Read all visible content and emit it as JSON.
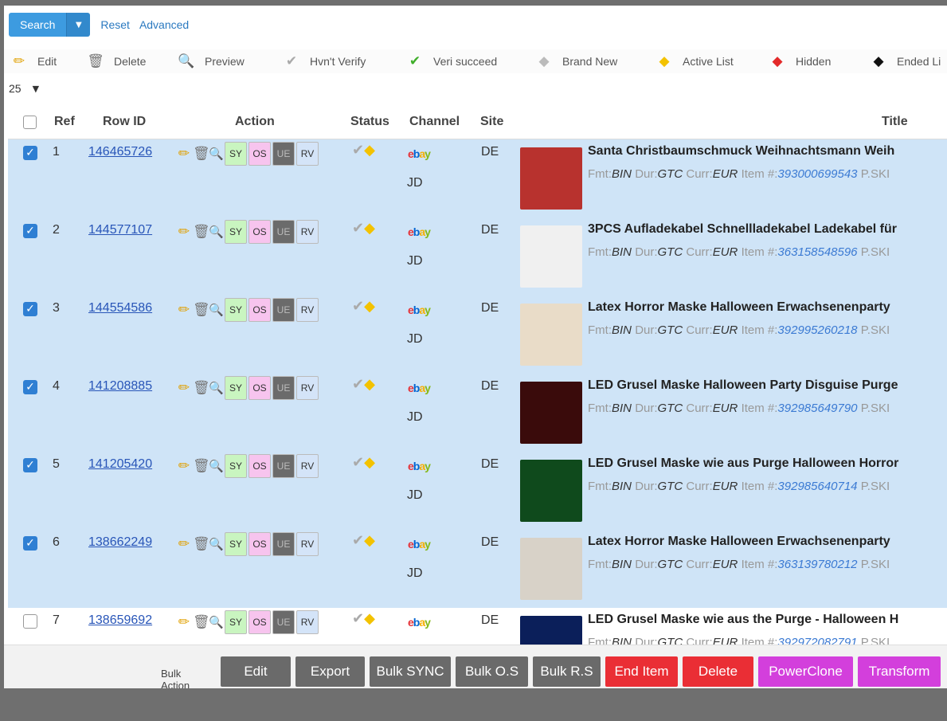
{
  "topbar": {
    "search_label": "Search",
    "reset_label": "Reset",
    "advanced_label": "Advanced"
  },
  "legend": [
    {
      "label": "Edit",
      "icon": "pencil-icon"
    },
    {
      "label": "Delete",
      "icon": "trash-icon"
    },
    {
      "label": "Preview",
      "icon": "magnifier-icon"
    },
    {
      "label": "Hvn't Verify",
      "icon": "gray-check-icon"
    },
    {
      "label": "Veri succeed",
      "icon": "green-check-icon"
    },
    {
      "label": "Brand New",
      "icon": "gray-tag-icon"
    },
    {
      "label": "Active List",
      "icon": "yellow-tag-icon"
    },
    {
      "label": "Hidden",
      "icon": "red-tag-icon"
    },
    {
      "label": "Ended Li",
      "icon": "black-tag-icon"
    }
  ],
  "page_size": "25",
  "columns": {
    "ref": "Ref",
    "row_id": "Row ID",
    "action": "Action",
    "status": "Status",
    "channel": "Channel",
    "site": "Site",
    "title": "Title"
  },
  "tag_labels": {
    "sy": "SY",
    "os": "OS",
    "ue": "UE",
    "rv": "RV"
  },
  "rows": [
    {
      "checked": true,
      "ref": "1",
      "row_id": "146465726",
      "channel": "JD",
      "site": "DE",
      "title": "Santa Christbaumschmuck Weihnachtsmann Weih",
      "fmt": "BIN",
      "dur": "GTC",
      "curr": "EUR",
      "item_no": "393000699543",
      "thumb_color": "#b8322e"
    },
    {
      "checked": true,
      "ref": "2",
      "row_id": "144577107",
      "channel": "JD",
      "site": "DE",
      "title": "3PCS Aufladekabel Schnellladekabel Ladekabel für",
      "fmt": "BIN",
      "dur": "GTC",
      "curr": "EUR",
      "item_no": "363158548596",
      "thumb_color": "#f0f0f0"
    },
    {
      "checked": true,
      "ref": "3",
      "row_id": "144554586",
      "channel": "JD",
      "site": "DE",
      "title": "Latex Horror Maske Halloween Erwachsenenparty",
      "fmt": "BIN",
      "dur": "GTC",
      "curr": "EUR",
      "item_no": "392995260218",
      "thumb_color": "#e9dcc8"
    },
    {
      "checked": true,
      "ref": "4",
      "row_id": "141208885",
      "channel": "JD",
      "site": "DE",
      "title": "LED Grusel Maske Halloween Party Disguise Purge",
      "fmt": "BIN",
      "dur": "GTC",
      "curr": "EUR",
      "item_no": "392985649790",
      "thumb_color": "#3a0b0b"
    },
    {
      "checked": true,
      "ref": "5",
      "row_id": "141205420",
      "channel": "JD",
      "site": "DE",
      "title": "LED Grusel Maske wie aus Purge Halloween Horror",
      "fmt": "BIN",
      "dur": "GTC",
      "curr": "EUR",
      "item_no": "392985640714",
      "thumb_color": "#0f4a1c"
    },
    {
      "checked": true,
      "ref": "6",
      "row_id": "138662249",
      "channel": "JD",
      "site": "DE",
      "title": "Latex Horror Maske Halloween Erwachsenenparty",
      "fmt": "BIN",
      "dur": "GTC",
      "curr": "EUR",
      "item_no": "363139780212",
      "thumb_color": "#d8d2c8"
    },
    {
      "checked": false,
      "ref": "7",
      "row_id": "138659692",
      "channel": "JD",
      "site": "DE",
      "title": "LED Grusel Maske wie aus the Purge - Halloween H",
      "fmt": "BIN",
      "dur": "GTC",
      "curr": "EUR",
      "item_no": "392972082791",
      "thumb_color": "#0b1f5a"
    }
  ],
  "meta_labels": {
    "fmt": "Fmt:",
    "dur": "Dur:",
    "curr": "Curr:",
    "item": "Item #:",
    "sku": "P.SKI"
  },
  "bulk": {
    "label": "Bulk Action",
    "buttons": [
      {
        "label": "Edit",
        "style": "dark"
      },
      {
        "label": "Export",
        "style": "dark"
      },
      {
        "label": "Bulk SYNC",
        "style": "dark"
      },
      {
        "label": "Bulk O.S",
        "style": "dark"
      },
      {
        "label": "Bulk R.S",
        "style": "dark"
      },
      {
        "label": "End Item",
        "style": "red"
      },
      {
        "label": "Delete",
        "style": "red"
      },
      {
        "label": "PowerClone",
        "style": "mag"
      },
      {
        "label": "Transform",
        "style": "mag"
      }
    ]
  },
  "colors": {
    "selected_row": "#cfe4f7",
    "link": "#2855b8",
    "search_button": "#3d9be0",
    "red_button": "#ea2e35",
    "magenta_button": "#d33fdc"
  }
}
